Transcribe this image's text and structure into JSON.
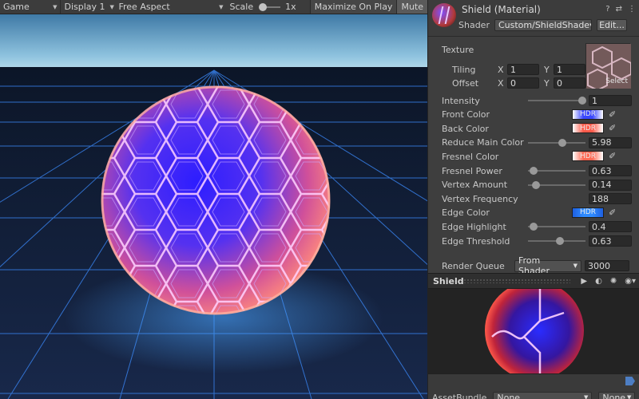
{
  "game_toolbar": {
    "tab": "Game",
    "display": "Display 1",
    "aspect": "Free Aspect",
    "scale_label": "Scale",
    "scale_value": "1x",
    "maximize": "Maximize On Play",
    "mute": "Mute"
  },
  "inspector": {
    "title": "Shield (Material)",
    "shader_label": "Shader",
    "shader_value": "Custom/ShieldShade",
    "edit_label": "Edit...",
    "texture": {
      "label": "Texture",
      "tiling_label": "Tiling",
      "offset_label": "Offset",
      "tiling_x": "1",
      "tiling_y": "1",
      "offset_x": "0",
      "offset_y": "0",
      "x_label": "X",
      "y_label": "Y",
      "select_label": "Select"
    },
    "properties": [
      {
        "label": "Intensity",
        "kind": "slider",
        "value": "1",
        "slider": 0.95
      },
      {
        "label": "Front Color",
        "kind": "color",
        "hdr": "HDR",
        "colors": [
          "#ffffff",
          "#3a47ff"
        ]
      },
      {
        "label": "Back Color",
        "kind": "color",
        "hdr": "HDR",
        "colors": [
          "#ffffff",
          "#ff5a4a"
        ]
      },
      {
        "label": "Reduce Main Color",
        "kind": "slider",
        "value": "5.98",
        "slider": 0.6
      },
      {
        "label": "Fresnel Color",
        "kind": "color",
        "hdr": "HDR",
        "colors": [
          "#ffffff",
          "#ff6a55"
        ]
      },
      {
        "label": "Fresnel Power",
        "kind": "slider",
        "value": "0.63",
        "slider": 0.1
      },
      {
        "label": "Vertex Amount",
        "kind": "slider",
        "value": "0.14",
        "slider": 0.14
      },
      {
        "label": "Vertex Frequency",
        "kind": "number",
        "value": "188"
      },
      {
        "label": "Edge Color",
        "kind": "color",
        "hdr": "HDR",
        "colors": [
          "#1e5fe0",
          "#2f8bff"
        ]
      },
      {
        "label": "Edge Highlight",
        "kind": "slider",
        "value": "0.4",
        "slider": 0.1
      },
      {
        "label": "Edge Threshold",
        "kind": "slider",
        "value": "0.63",
        "slider": 0.55
      }
    ],
    "render_queue_label": "Render Queue",
    "render_queue_mode": "From Shader",
    "render_queue_value": "3000"
  },
  "preview": {
    "title": "Shield"
  },
  "asset_bundle": {
    "label": "AssetBundle",
    "value": "None",
    "variant": "None"
  },
  "colors": {
    "sphere_blue": "#3b2bff",
    "sphere_pink": "#ff6a9a",
    "grid": "#3c8cff",
    "sky": "#7fb6d8"
  }
}
